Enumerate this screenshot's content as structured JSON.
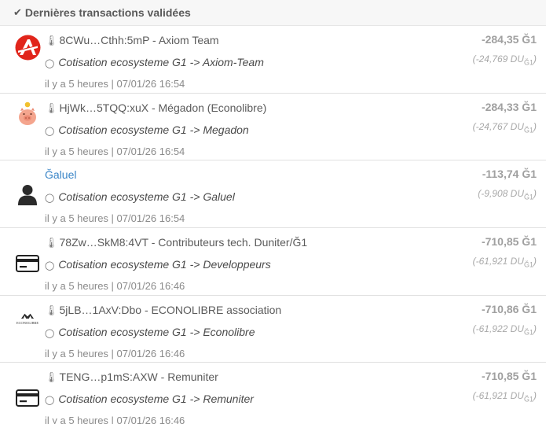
{
  "header": {
    "check_glyph": "✔",
    "title": "Dernières transactions validées"
  },
  "key_glyph": "🌡",
  "bubble_glyph": "💬",
  "transactions": [
    {
      "avatar_icon": "axiom-logo-icon",
      "pubkey": "8CWu…Cthh:5mP - Axiom Team",
      "comment": "Cotisation ecosysteme G1 -> Axiom-Team",
      "time": "il y a 5 heures | 07/01/26 16:54",
      "amount": "-284,35 Ğ1",
      "du_value": "(-24,769 DU",
      "du_sub": "Ğ1",
      "du_close": ")"
    },
    {
      "avatar_icon": "piggy-bank-icon",
      "pubkey": "HjWk…5TQQ:xuX - Mégadon (Econolibre)",
      "comment": "Cotisation ecosysteme G1 -> Megadon",
      "time": "il y a 5 heures | 07/01/26 16:54",
      "amount": "-284,33 Ğ1",
      "du_value": "(-24,767 DU",
      "du_sub": "Ğ1",
      "du_close": ")"
    },
    {
      "avatar_icon": "person-silhouette-icon",
      "member": "Ğaluel",
      "comment": "Cotisation ecosysteme G1 -> Galuel",
      "time": "il y a 5 heures | 07/01/26 16:54",
      "amount": "-113,74 Ğ1",
      "du_value": "(-9,908 DU",
      "du_sub": "Ğ1",
      "du_close": ")"
    },
    {
      "avatar_icon": "credit-card-icon",
      "pubkey": "78Zw…SkM8:4VT - Contributeurs tech. Duniter/Ğ1",
      "comment": "Cotisation ecosysteme G1 -> Developpeurs",
      "time": "il y a 5 heures | 07/01/26 16:46",
      "amount": "-710,85 Ğ1",
      "du_value": "(-61,921 DU",
      "du_sub": "Ğ1",
      "du_close": ")"
    },
    {
      "avatar_icon": "econolibre-logo-icon",
      "logo_text": "ECONOLIBRE",
      "pubkey": "5jLB…1AxV:Dbo - ECONOLIBRE association",
      "comment": "Cotisation ecosysteme G1 -> Econolibre",
      "time": "il y a 5 heures | 07/01/26 16:46",
      "amount": "-710,86 Ğ1",
      "du_value": "(-61,922 DU",
      "du_sub": "Ğ1",
      "du_close": ")"
    },
    {
      "avatar_icon": "credit-card-icon",
      "pubkey": "TENG…p1mS:AXW - Remuniter",
      "comment": "Cotisation ecosysteme G1 -> Remuniter",
      "time": "il y a 5 heures | 07/01/26 16:46",
      "amount": "-710,85 Ğ1",
      "du_value": "(-61,921 DU",
      "du_sub": "Ğ1",
      "du_close": ")"
    }
  ]
}
